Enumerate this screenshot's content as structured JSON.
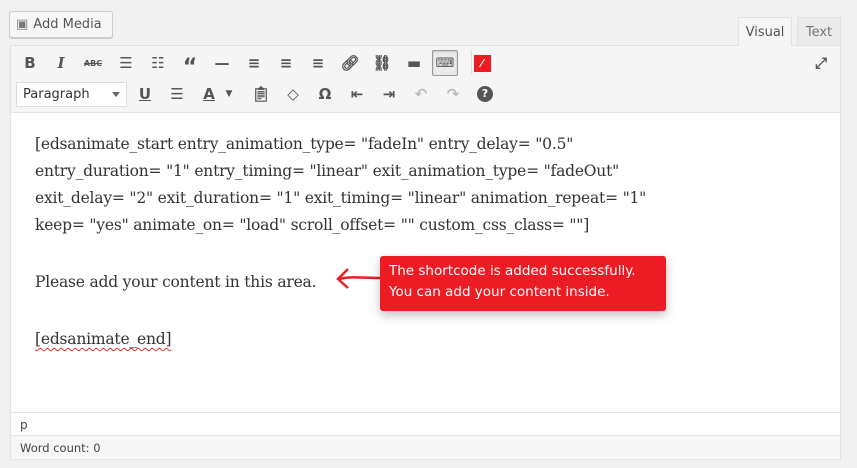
{
  "header": {
    "add_media": "Add Media",
    "tabs": [
      {
        "label": "Visual",
        "active": true
      },
      {
        "label": "Text",
        "active": false
      }
    ]
  },
  "toolbar": {
    "format_select": "Paragraph",
    "row1": [
      "bold",
      "italic",
      "strikethrough",
      "bullet-list",
      "numbered-list",
      "blockquote",
      "horizontal-line",
      "align-left",
      "align-center",
      "align-right",
      "insert-link",
      "remove-link",
      "read-more",
      "toolbar-toggle",
      "animate-shortcode"
    ],
    "row2": [
      "underline",
      "justify",
      "text-color",
      "paste-as-text",
      "clear-formatting",
      "special-character",
      "outdent",
      "indent",
      "undo",
      "redo",
      "help"
    ]
  },
  "content": {
    "lines": [
      "[edsanimate_start entry_animation_type= \"fadeIn\" entry_delay= \"0.5\"",
      "entry_duration= \"1\" entry_timing= \"linear\" exit_animation_type= \"fadeOut\"",
      "exit_delay= \"2\" exit_duration= \"1\" exit_timing= \"linear\" animation_repeat= \"1\"",
      "keep= \"yes\" animate_on= \"load\" scroll_offset= \"\" custom_css_class= \"\"]"
    ],
    "paragraph": "Please add your content in this area.",
    "end": "[edsanimate_end]"
  },
  "tooltip": {
    "line1": "The shortcode is added successfully.",
    "line2": "You can add your content inside.",
    "color": "#ed1c24"
  },
  "status": {
    "path": "p",
    "word_count": "Word count: 0"
  }
}
